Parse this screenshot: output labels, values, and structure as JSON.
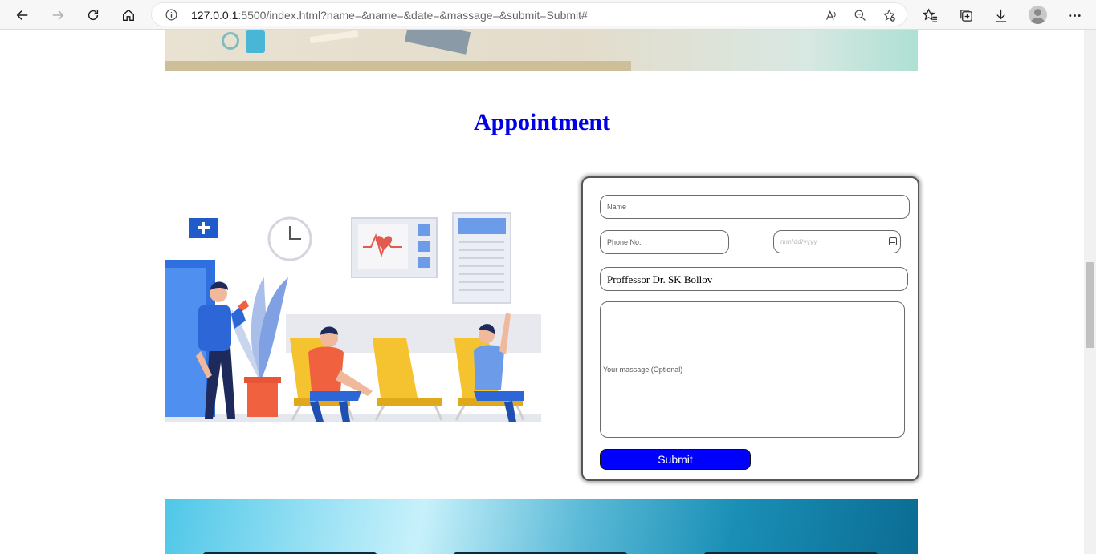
{
  "browser": {
    "url_host": "127.0.0.1",
    "url_rest": ":5500/index.html?name=&name=&date=&massage=&submit=Submit#",
    "icons": [
      "back-icon",
      "forward-icon",
      "refresh-icon",
      "home-icon",
      "info-icon",
      "read-aloud-icon",
      "zoom-icon",
      "add-favorite-icon",
      "favorites-icon",
      "collections-icon",
      "downloads-icon",
      "profile-avatar",
      "more-icon"
    ]
  },
  "page": {
    "section_title": "Appointment",
    "form": {
      "name_placeholder": "Name",
      "phone_placeholder": "Phone No.",
      "date_placeholder": "mm/dd/yyyy",
      "doctor_value": "Proffessor Dr. SK Bollov",
      "message_placeholder": "Your massage (Optional)",
      "submit_label": "Submit"
    },
    "colors": {
      "title": "#0000e6",
      "submit_bg": "#0000ff"
    }
  }
}
